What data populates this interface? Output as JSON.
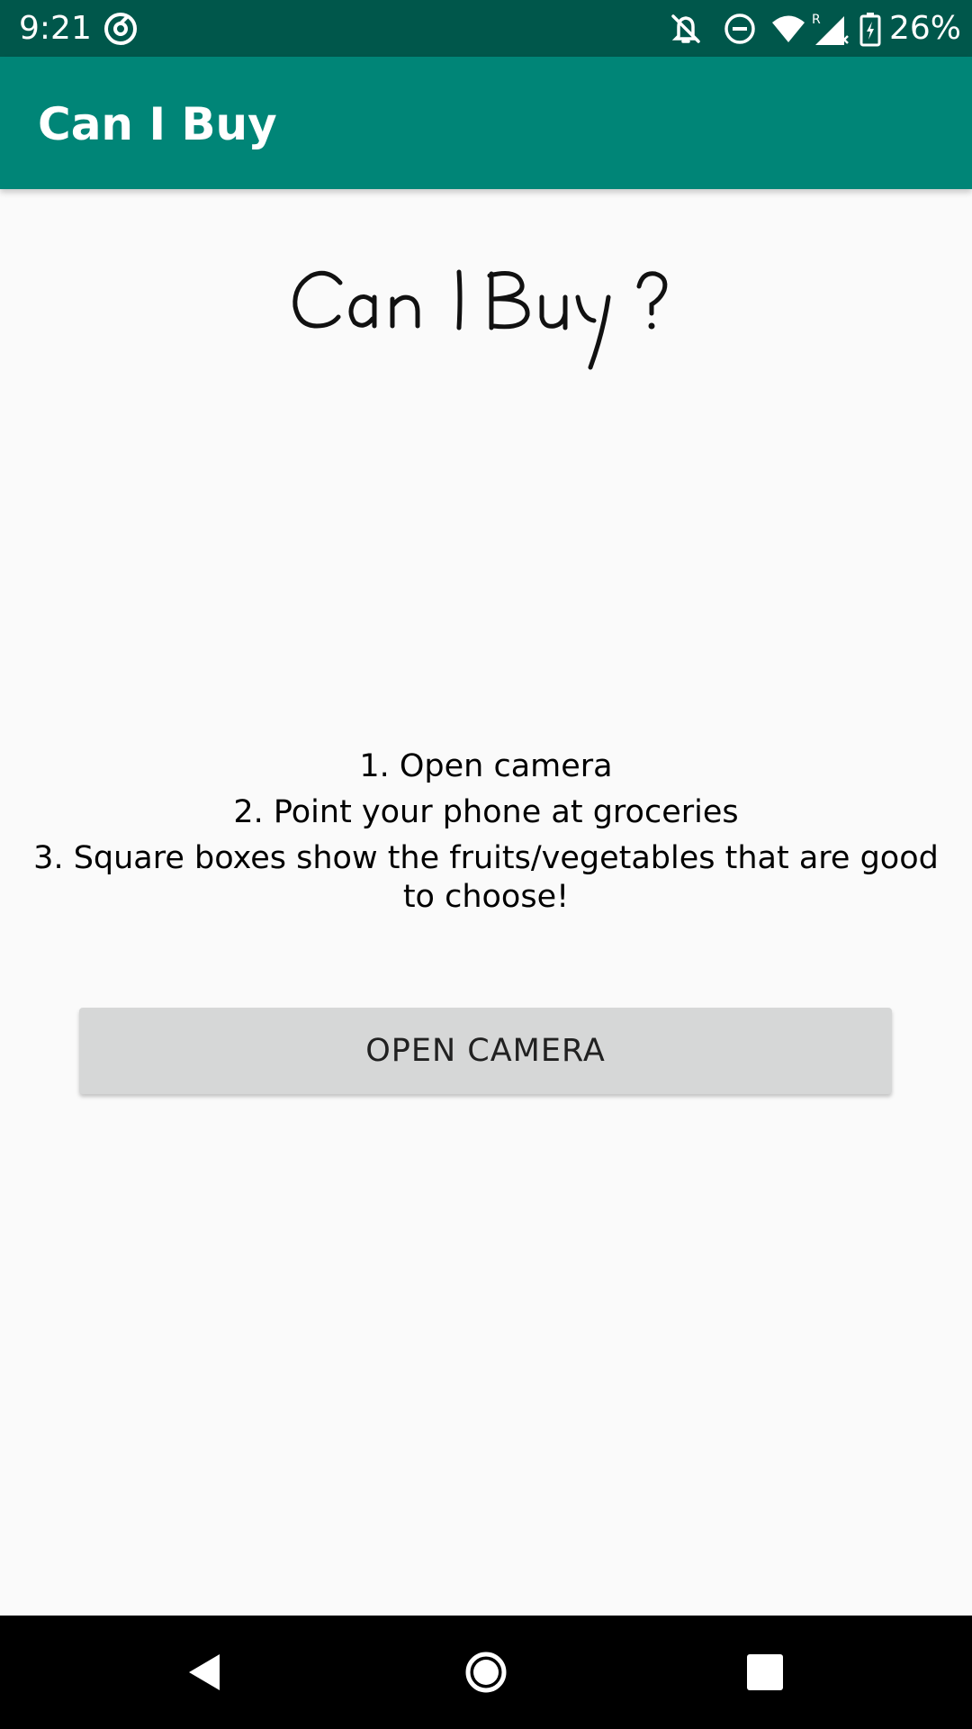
{
  "status_bar": {
    "time": "9:21",
    "battery": "26%",
    "icons": [
      "at-sign-icon",
      "bell-off-icon",
      "do-not-disturb-icon",
      "wifi-icon",
      "signal-roaming-icon",
      "battery-charging-icon"
    ],
    "roaming_label": "R"
  },
  "app_bar": {
    "title": "Can I Buy"
  },
  "logo": {
    "text": "Can I Buy ?"
  },
  "instructions": {
    "steps": [
      "1. Open camera",
      "2. Point your phone at groceries",
      "3. Square boxes show the fruits/vegetables that are good to choose!"
    ]
  },
  "open_camera_button": {
    "label": "OPEN CAMERA"
  },
  "nav_bar": {
    "icons": [
      "back-icon",
      "home-icon",
      "recents-icon"
    ]
  },
  "colors": {
    "status_bar": "#00574b",
    "app_bar": "#008577",
    "background": "#fafafa",
    "button": "#d6d7d7"
  }
}
